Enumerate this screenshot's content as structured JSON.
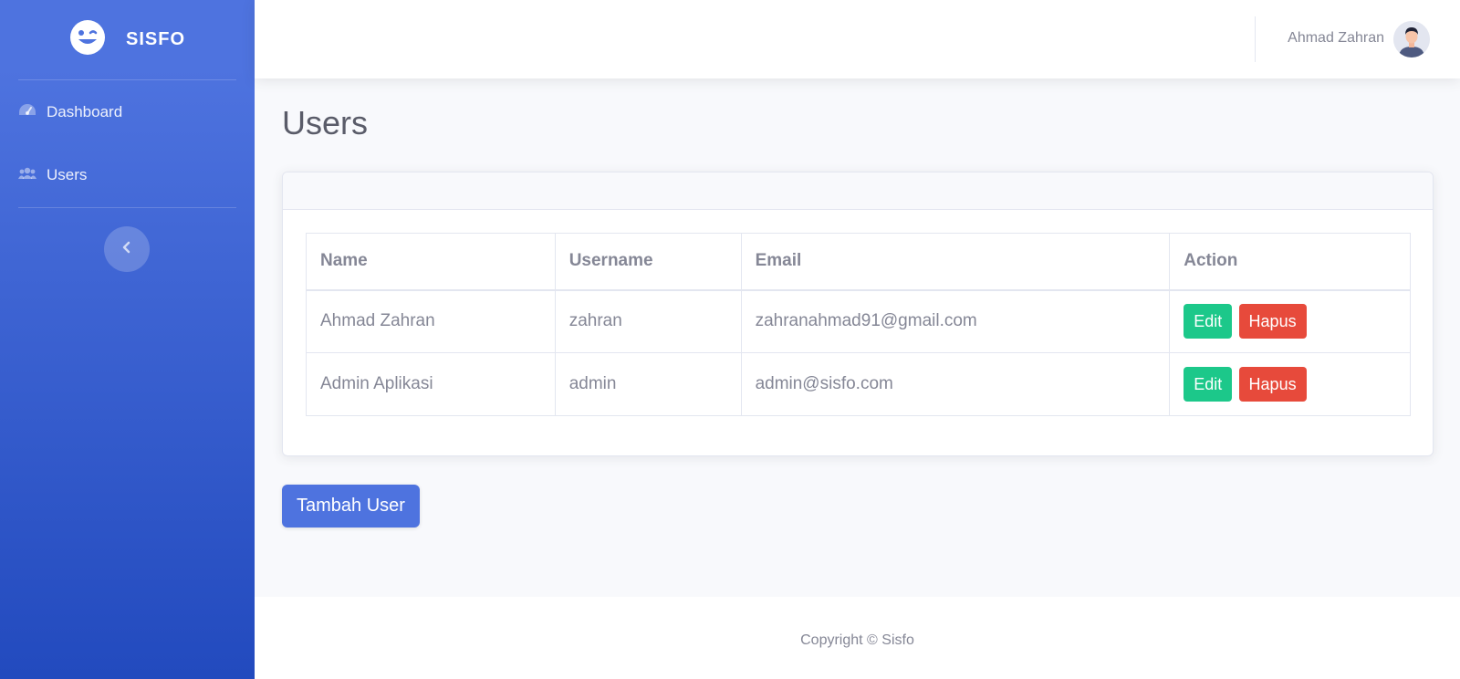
{
  "brand": {
    "name": "SISFO",
    "logo_icon": "laugh-wink-icon"
  },
  "sidebar": {
    "items": [
      {
        "label": "Dashboard",
        "icon": "tachometer-icon"
      },
      {
        "label": "Users",
        "icon": "users-icon"
      }
    ],
    "toggle_icon": "chevron-left-icon"
  },
  "topbar": {
    "user_name": "Ahmad Zahran",
    "avatar_icon": "user-avatar"
  },
  "page": {
    "title": "Users"
  },
  "table": {
    "headers": [
      "Name",
      "Username",
      "Email",
      "Action"
    ],
    "rows": [
      {
        "name": "Ahmad Zahran",
        "username": "zahran",
        "email": "zahranahmad91@gmail.com",
        "edit": "Edit",
        "delete": "Hapus"
      },
      {
        "name": "Admin Aplikasi",
        "username": "admin",
        "email": "admin@sisfo.com",
        "edit": "Edit",
        "delete": "Hapus"
      }
    ]
  },
  "actions": {
    "add_user": "Tambah User"
  },
  "footer": {
    "copyright": "Copyright © Sisfo"
  },
  "colors": {
    "primary": "#4e73df",
    "success": "#1cc88a",
    "danger": "#e74a3b",
    "text": "#858796"
  }
}
